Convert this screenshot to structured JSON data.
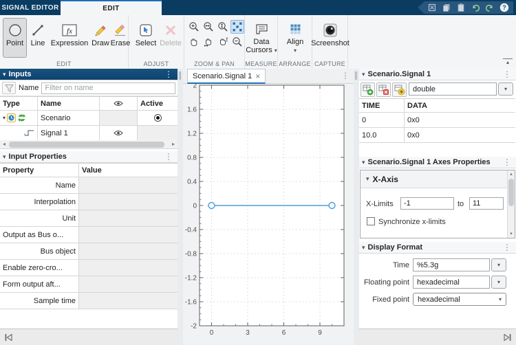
{
  "glyphs": {
    "down_arrow": "▾",
    "up_arrow": "▴",
    "left_arrow": "◂",
    "right_arrow": "▸",
    "dots": "⋮",
    "close": "×"
  },
  "titlebar": {
    "tabs": [
      {
        "label": "SIGNAL EDITOR"
      },
      {
        "label": "EDIT"
      }
    ]
  },
  "toolbar": {
    "edit_group": {
      "label": "EDIT",
      "point": "Point",
      "line": "Line",
      "expression": "Expression",
      "draw": "Draw",
      "erase": "Erase"
    },
    "adjust_group": {
      "label": "ADJUST",
      "select": "Select",
      "delete": "Delete"
    },
    "zoom_group": {
      "label": "ZOOM & PAN"
    },
    "measure_group": {
      "label": "MEASURE",
      "data_cursors_line1": "Data",
      "data_cursors_line2": "Cursors"
    },
    "arrange_group": {
      "label": "ARRANGE",
      "align": "Align"
    },
    "capture_group": {
      "label": "CAPTURE",
      "screenshot": "Screenshot"
    }
  },
  "inputs_panel": {
    "title": "Inputs",
    "filter_label": "Name",
    "filter_placeholder": "Filter on name",
    "col_type": "Type",
    "col_name": "Name",
    "col_active": "Active",
    "rows": [
      {
        "name": "Scenario"
      },
      {
        "name": "Signal 1"
      }
    ]
  },
  "properties_panel": {
    "title": "Input Properties",
    "col_property": "Property",
    "col_value": "Value",
    "rows": [
      "Name",
      "Interpolation",
      "Unit",
      "Output as Bus o...",
      "Bus object",
      "Enable zero-cro...",
      "Form output aft...",
      "Sample time"
    ]
  },
  "plot_panel": {
    "tab_label": "Scenario.Signal 1"
  },
  "signal_panel": {
    "title": "Scenario.Signal 1",
    "datatype": "double",
    "col_time": "TIME",
    "col_data": "DATA",
    "rows": [
      {
        "time": "0",
        "data": "0x0"
      },
      {
        "time": "10.0",
        "data": "0x0"
      }
    ]
  },
  "axes_panel": {
    "title": "Scenario.Signal 1 Axes Properties",
    "xaxis": "X-Axis",
    "xlimits_label": "X-Limits",
    "xmin": "-1",
    "to": "to",
    "xmax": "11",
    "sync_label": "Synchronize x-limits",
    "sync_checked": false
  },
  "display_panel": {
    "title": "Display Format",
    "time_label": "Time",
    "time_value": "%5.3g",
    "float_label": "Floating point",
    "float_value": "hexadecimal",
    "fixed_label": "Fixed point",
    "fixed_value": "hexadecimal"
  },
  "chart_data": {
    "type": "line",
    "title": "",
    "xlabel": "",
    "ylabel": "",
    "xlim": [
      -1,
      11
    ],
    "ylim": [
      -2,
      2
    ],
    "xticks": [
      0,
      3,
      6,
      9
    ],
    "x_minor_ticks": [
      1,
      2,
      4,
      5,
      7,
      8,
      10
    ],
    "yticks": [
      -2,
      -1.6,
      -1.2,
      -0.8,
      -0.4,
      0,
      0.4,
      0.8,
      1.2,
      1.6,
      2
    ],
    "y_minor_step": 0.1,
    "grid": true,
    "series": [
      {
        "name": "Scenario.Signal 1",
        "x": [
          0,
          10
        ],
        "y": [
          0,
          0
        ],
        "color": "#4d9fd8",
        "marker": "circle",
        "marker_fill": "#f4f9fd"
      }
    ]
  }
}
